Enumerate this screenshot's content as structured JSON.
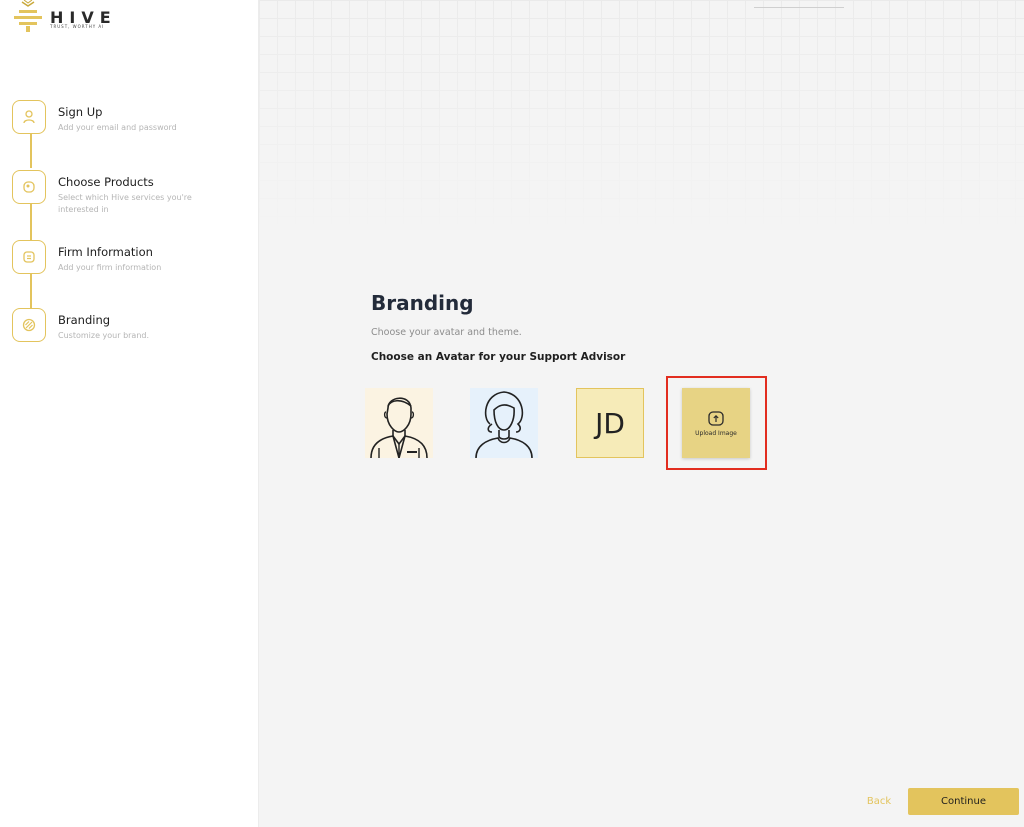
{
  "app": {
    "logo_text": "HIVE",
    "logo_tagline": "TRUST, WORTHY AI"
  },
  "steps": [
    {
      "title": "Sign Up",
      "description": "Add your email and password",
      "icon": "user-icon"
    },
    {
      "title": "Choose Products",
      "description": "Select which Hive services you're interested in",
      "icon": "products-icon"
    },
    {
      "title": "Firm Information",
      "description": "Add your firm information",
      "icon": "document-icon"
    },
    {
      "title": "Branding",
      "description": "Customize your brand.",
      "icon": "palette-icon"
    }
  ],
  "main": {
    "title": "Branding",
    "subtitle": "Choose your avatar and theme.",
    "avatar_section_label": "Choose an Avatar for your Support Advisor",
    "avatars": [
      {
        "type": "male",
        "icon": "male-avatar-icon"
      },
      {
        "type": "female",
        "icon": "female-avatar-icon"
      },
      {
        "type": "initials",
        "text": "JD"
      }
    ],
    "upload_label": "Upload Image"
  },
  "footer": {
    "back_label": "Back",
    "continue_label": "Continue"
  },
  "colors": {
    "accent": "#e3c45d",
    "highlight": "#e22d1f",
    "male_bg": "#fbf3e2",
    "female_bg": "#e6f1fb",
    "initials_bg": "#f6ebb8",
    "upload_bg": "#e7d384"
  }
}
